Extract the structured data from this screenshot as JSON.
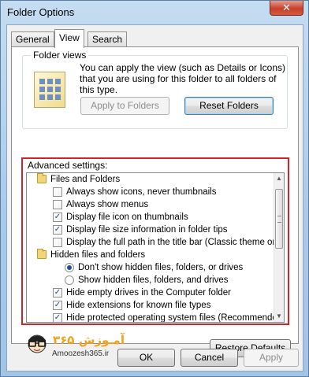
{
  "window": {
    "title": "Folder Options",
    "close_glyph": "✕"
  },
  "tabs": [
    {
      "label": "General",
      "active": false
    },
    {
      "label": "View",
      "active": true
    },
    {
      "label": "Search",
      "active": false
    }
  ],
  "folder_views": {
    "title": "Folder views",
    "description": "You can apply the view (such as Details or Icons) that you are using for this folder to all folders of this type.",
    "apply_label": "Apply to Folders",
    "reset_label": "Reset Folders"
  },
  "advanced": {
    "title": "Advanced settings:",
    "items": [
      {
        "kind": "folder",
        "label": "Files and Folders"
      },
      {
        "kind": "checkbox",
        "checked": false,
        "label": "Always show icons, never thumbnails"
      },
      {
        "kind": "checkbox",
        "checked": false,
        "label": "Always show menus"
      },
      {
        "kind": "checkbox",
        "checked": true,
        "label": "Display file icon on thumbnails"
      },
      {
        "kind": "checkbox",
        "checked": true,
        "label": "Display file size information in folder tips"
      },
      {
        "kind": "checkbox",
        "checked": false,
        "label": "Display the full path in the title bar (Classic theme only)"
      },
      {
        "kind": "folder",
        "label": "Hidden files and folders"
      },
      {
        "kind": "radio",
        "checked": true,
        "label": "Don't show hidden files, folders, or drives"
      },
      {
        "kind": "radio",
        "checked": false,
        "label": "Show hidden files, folders, and drives"
      },
      {
        "kind": "checkbox",
        "checked": true,
        "label": "Hide empty drives in the Computer folder"
      },
      {
        "kind": "checkbox",
        "checked": true,
        "label": "Hide extensions for known file types"
      },
      {
        "kind": "checkbox",
        "checked": true,
        "label": "Hide protected operating system files (Recommended)"
      }
    ]
  },
  "watermark": {
    "fa": "آمـوزش ۳۶۵",
    "en": "Amoozesh365.ir"
  },
  "buttons": {
    "restore": "Restore Defaults",
    "ok": "OK",
    "cancel": "Cancel",
    "apply": "Apply"
  },
  "colors": {
    "highlight_frame": "#d6202a",
    "accent": "#1f4e8c",
    "logo": "#f2a11c"
  }
}
